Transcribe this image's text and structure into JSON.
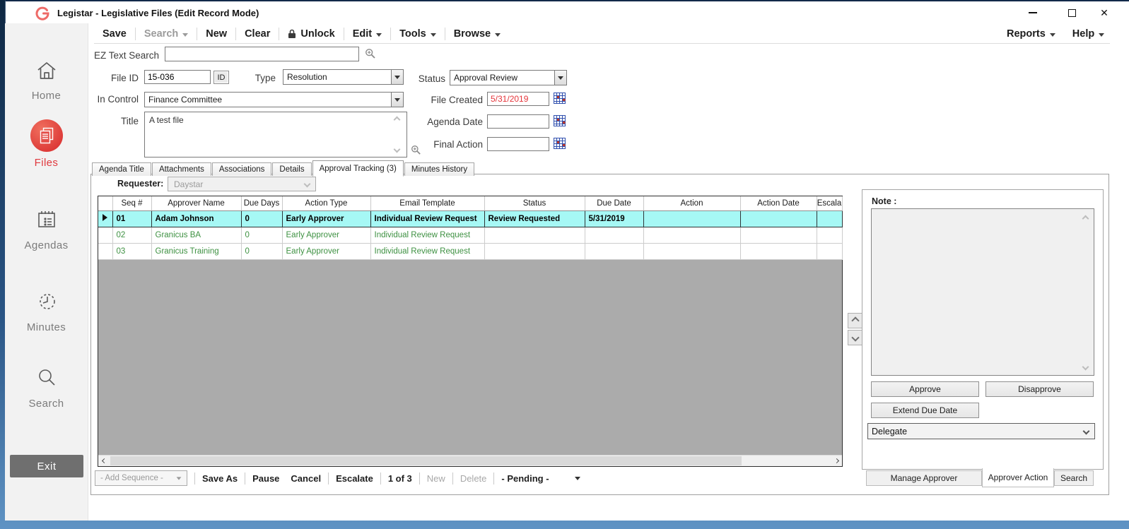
{
  "window": {
    "title": "Legistar - Legislative Files (Edit Record Mode)"
  },
  "sidebar": {
    "items": [
      {
        "label": "Home"
      },
      {
        "label": "Files"
      },
      {
        "label": "Agendas"
      },
      {
        "label": "Minutes"
      },
      {
        "label": "Search"
      }
    ],
    "exit": "Exit"
  },
  "menubar": {
    "save": "Save",
    "search": "Search",
    "new": "New",
    "clear": "Clear",
    "unlock": "Unlock",
    "edit": "Edit",
    "tools": "Tools",
    "browse": "Browse",
    "reports": "Reports",
    "help": "Help"
  },
  "ez_search": {
    "label": "EZ Text Search",
    "value": ""
  },
  "form": {
    "file_id": {
      "label": "File ID",
      "value": "15-036",
      "id_button": "ID"
    },
    "type": {
      "label": "Type",
      "value": "Resolution"
    },
    "status": {
      "label": "Status",
      "value": "Approval Review"
    },
    "in_control": {
      "label": "In Control",
      "value": "Finance Committee"
    },
    "file_created": {
      "label": "File Created",
      "value": "5/31/2019"
    },
    "title": {
      "label": "Title",
      "value": "A test file"
    },
    "agenda_date": {
      "label": "Agenda Date",
      "value": ""
    },
    "final_action": {
      "label": "Final Action",
      "value": ""
    }
  },
  "tabs": {
    "items": [
      "Agenda Title",
      "Attachments",
      "Associations",
      "Details",
      "Approval Tracking (3)",
      "Minutes History"
    ],
    "active": "Approval Tracking (3)"
  },
  "requester": {
    "label": "Requester:",
    "value": "Daystar"
  },
  "grid": {
    "columns": [
      "Seq #",
      "Approver Name",
      "Due Days",
      "Action Type",
      "Email Template",
      "Status",
      "Due Date",
      "Action",
      "Action Date",
      "Escala"
    ],
    "rows": [
      {
        "seq": "01",
        "name": "Adam Johnson",
        "due_days": "0",
        "action_type": "Early Approver",
        "email_template": "Individual Review Request",
        "status": "Review Requested",
        "due_date": "5/31/2019",
        "action": "",
        "action_date": "",
        "escala": ""
      },
      {
        "seq": "02",
        "name": "Granicus BA",
        "due_days": "0",
        "action_type": "Early Approver",
        "email_template": "Individual Review Request",
        "status": "",
        "due_date": "",
        "action": "",
        "action_date": "",
        "escala": ""
      },
      {
        "seq": "03",
        "name": "Granicus Training",
        "due_days": "0",
        "action_type": "Early Approver",
        "email_template": "Individual Review Request",
        "status": "",
        "due_date": "",
        "action": "",
        "action_date": "",
        "escala": ""
      }
    ]
  },
  "note_panel": {
    "label": "Note :",
    "note_value": "",
    "approve": "Approve",
    "disapprove": "Disapprove",
    "extend_due_date": "Extend Due Date",
    "delegate": "Delegate",
    "tabs": [
      "Manage Approver",
      "Approver Action",
      "Search"
    ],
    "active_tab": "Approver Action"
  },
  "bottom_toolbar": {
    "add_sequence": "- Add Sequence -",
    "save_as": "Save As",
    "pause": "Pause",
    "cancel": "Cancel",
    "escalate": "Escalate",
    "position": "1 of 3",
    "new": "New",
    "delete": "Delete",
    "pending": "- Pending -"
  },
  "colors": {
    "accent_red": "#e0393e",
    "selected_row_bg": "#a6f8f5",
    "approver_text_green": "#3e9142",
    "date_text_red": "#e5343a",
    "grid_filler_gray": "#ababab"
  }
}
